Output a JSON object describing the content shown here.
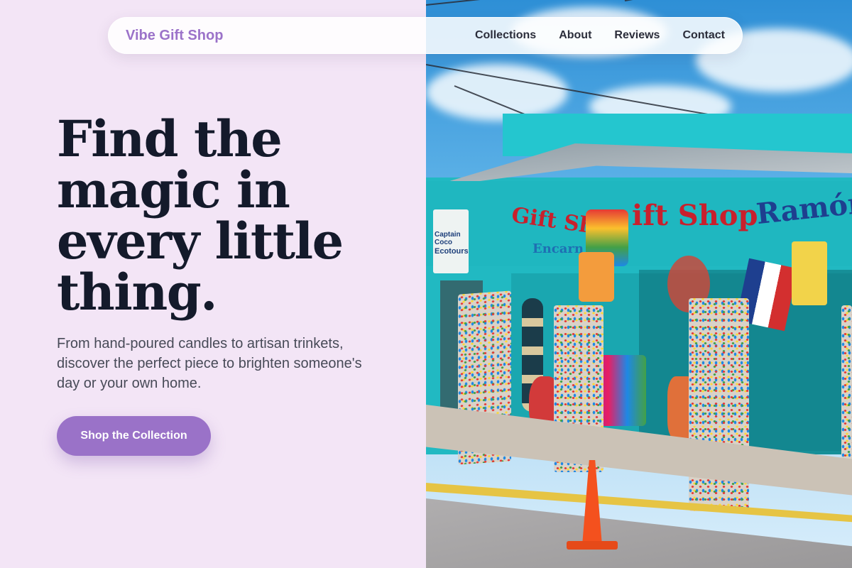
{
  "nav": {
    "brand": "Vibe Gift Shop",
    "links": [
      {
        "label": "Collections"
      },
      {
        "label": "About"
      },
      {
        "label": "Reviews"
      },
      {
        "label": "Contact"
      }
    ]
  },
  "hero": {
    "title_lines": [
      "Find the",
      "magic in",
      "every little",
      "thing."
    ],
    "subtitle": "From hand-poured candles to artisan trinkets, discover the perfect piece to brighten someone's day or your own home.",
    "cta_label": "Shop the Collection"
  },
  "photo": {
    "sign_left": "Gift Sho",
    "sign_left_sub": "Encarn",
    "sign_center": "ift Shop",
    "sign_right": "Ramón",
    "small_sign_line1": "Captain Coco",
    "small_sign_line2": "Ecotours"
  },
  "colors": {
    "background": "#f3e5f6",
    "accent": "#9a72c8",
    "brand": "#9b72c9",
    "heading": "#141a2b",
    "body_text": "#474a57"
  }
}
